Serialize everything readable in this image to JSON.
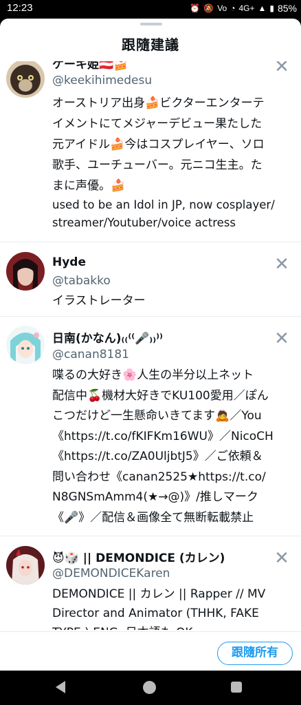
{
  "status_bar": {
    "time": "12:23",
    "network": "4G+",
    "battery": "85%"
  },
  "sheet": {
    "title": "跟隨建議"
  },
  "users": [
    {
      "name": "ケーキ姫🇦🇹🍰",
      "handle": "@keekihimedesu",
      "bio_lines": [
        "オーストリア出身🍰ビクターエンターテ",
        "イメントにてメジャーデビュー果たした",
        "元アイドル🍰今はコスプレイヤー、ソロ",
        "歌手、ユーチューバー。元ニコ生主。た",
        "まに声優。🍰"
      ],
      "bio_lines_en": [
        "used to be an Idol in JP, now cosplayer/",
        "streamer/Youtuber/voice actress"
      ]
    },
    {
      "name": "Hyde",
      "handle": "@tabakko",
      "bio_lines": [
        "イラストレーター"
      ]
    },
    {
      "name": "日南(かなん)₍₍⁽⁽🎤₎₎⁾⁾",
      "handle": "@canan8181",
      "bio_lines": [
        "喋るの大好き🌸人生の半分以上ネット",
        "配信中🍒機材大好きでKU100愛用／ぽん",
        "こつだけど一生懸命いきてます🙇／You",
        "《https://t.co/fKIFKm16WU》／NicoCH",
        "《https://t.co/ZA0UljbtJ5》／ご依頼＆",
        "問い合わせ《canan2525★https://t.co/",
        "N8GNSmAmm4(★→@)》/推しマーク",
        "《🎤》／配信＆画像全て無断転載禁止"
      ]
    },
    {
      "name": "😈🎲 || DEMONDICE (カレン)",
      "handle": "@DEMONDICEKaren",
      "bio_lines": [
        "DEMONDICE || カレン || Rapper // MV",
        "Director and Animator (THHK, FAKE",
        "TYPE.) ENG. 日本語も OK"
      ]
    }
  ],
  "footer": {
    "follow_all_label": "跟隨所有"
  },
  "icons": {
    "dismiss": "close-icon",
    "nav_back": "back-triangle-icon",
    "nav_home": "home-circle-icon",
    "nav_recent": "recent-apps-square-icon"
  }
}
